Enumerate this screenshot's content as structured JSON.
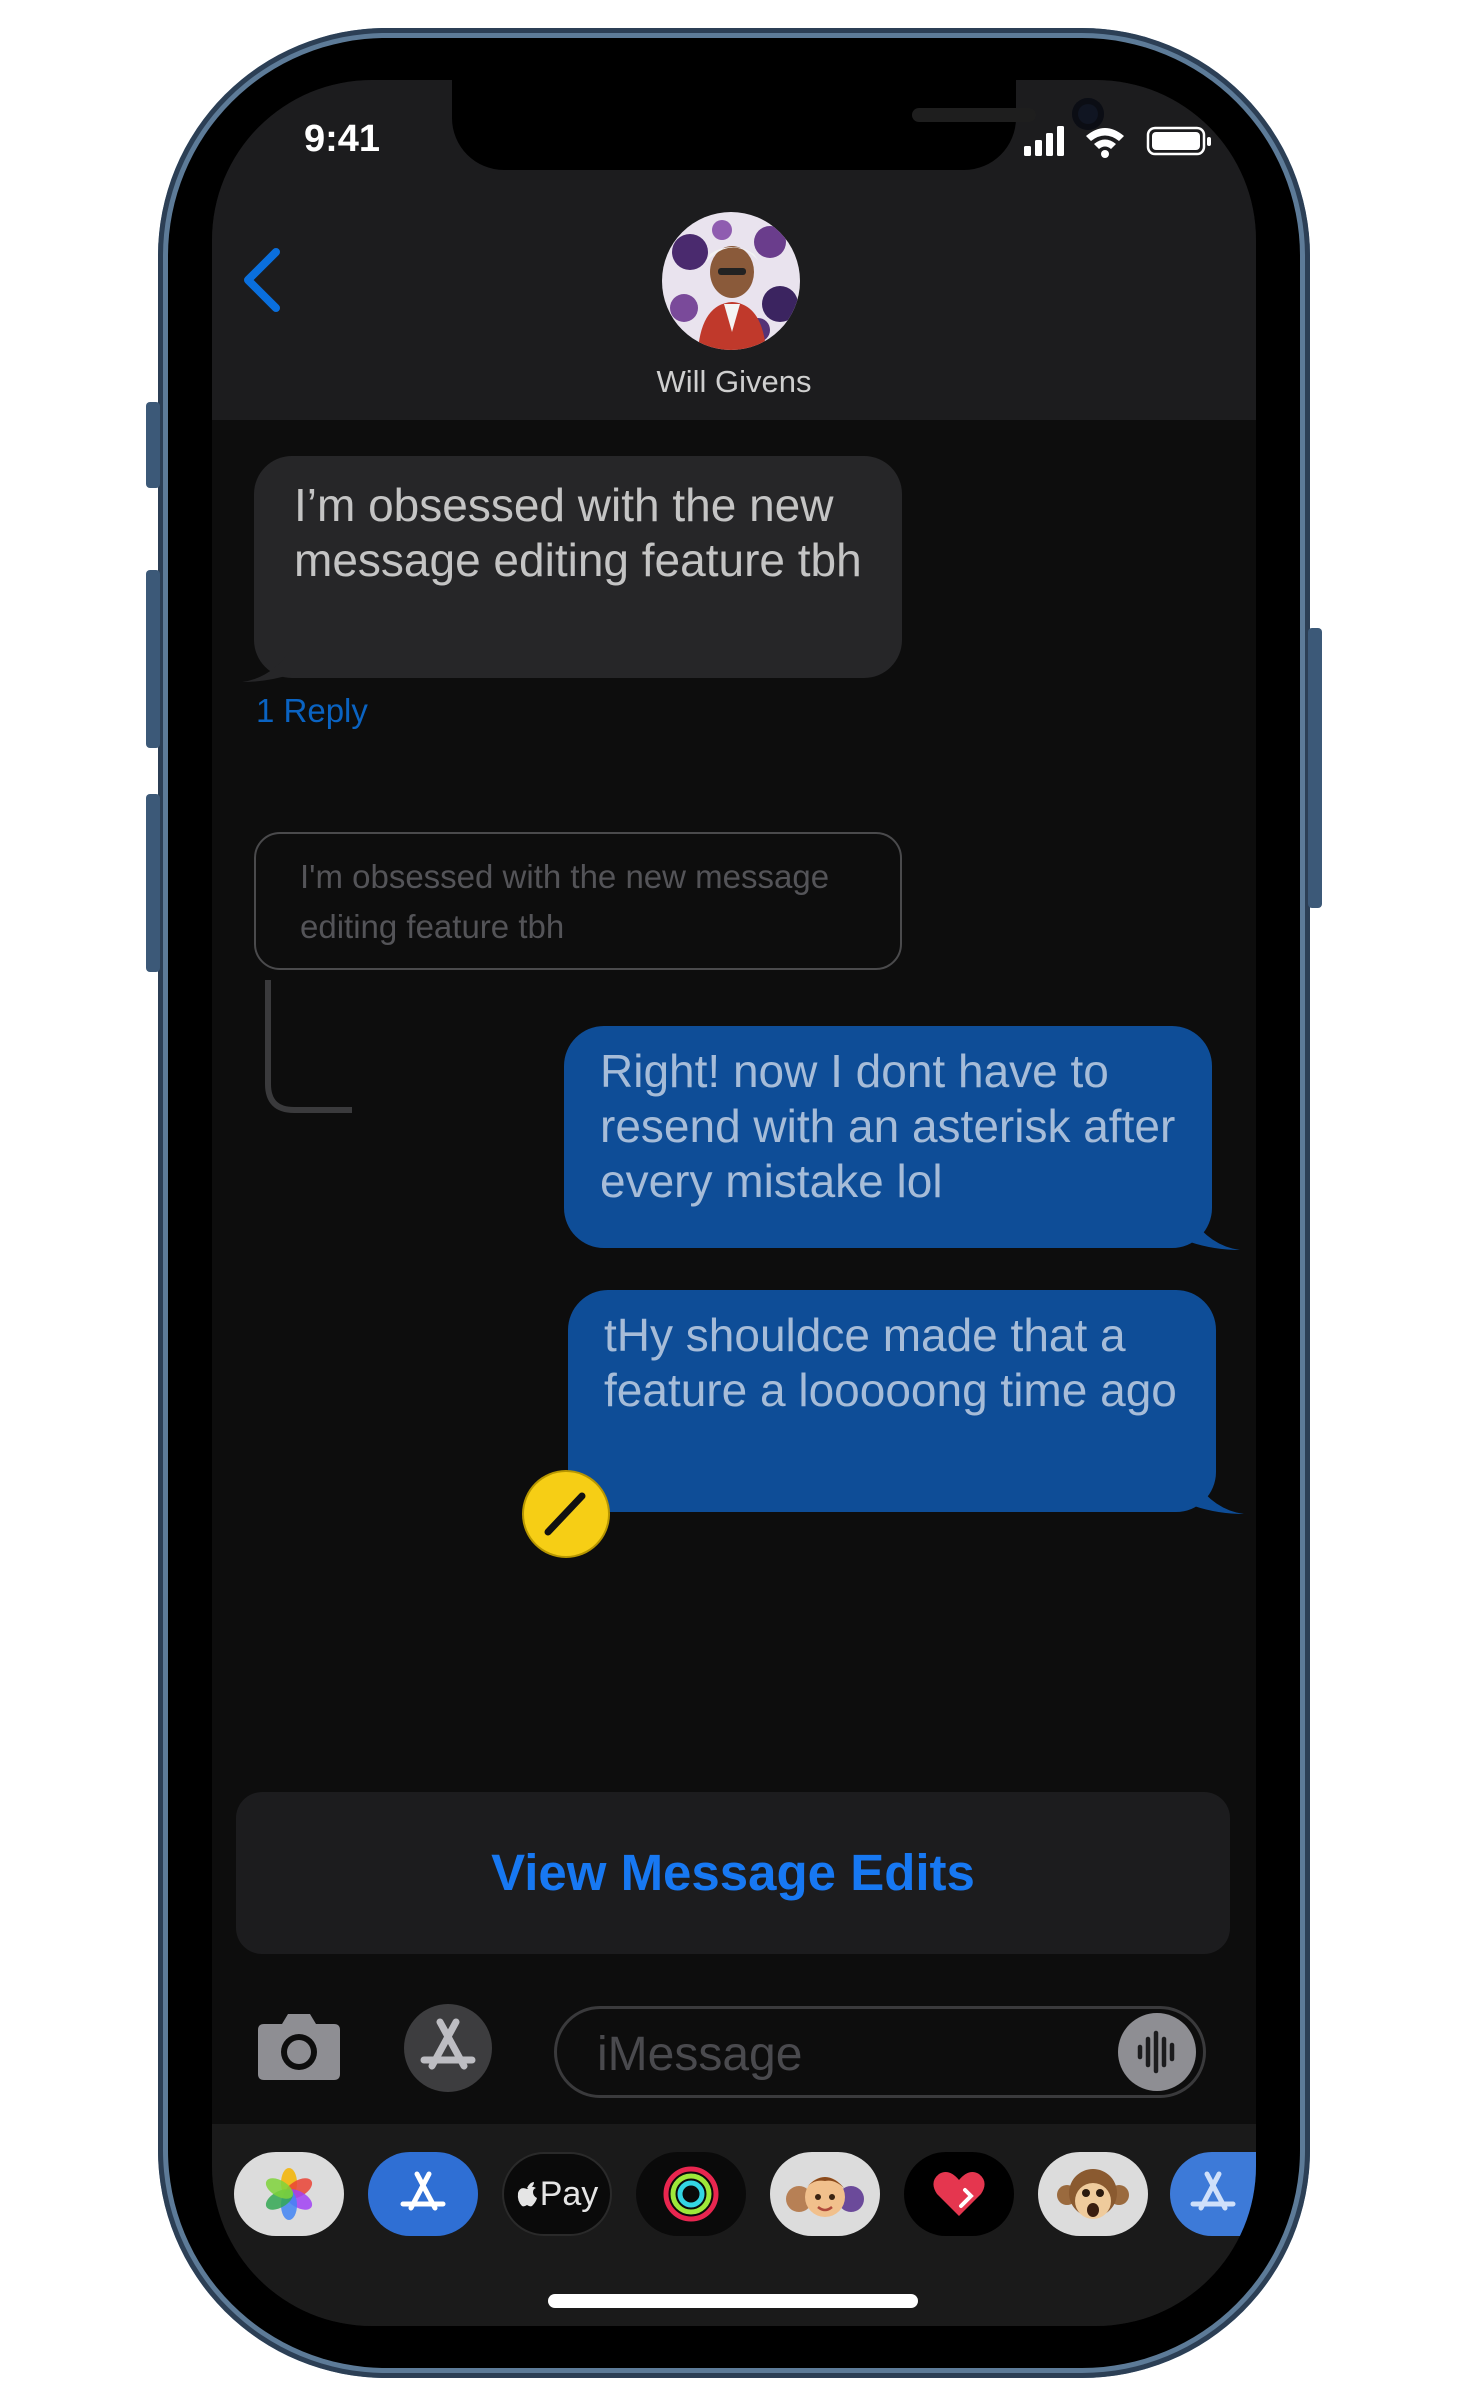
{
  "status_bar": {
    "time": "9:41"
  },
  "header": {
    "contact_name": "Will Givens"
  },
  "messages": [
    {
      "direction": "incoming",
      "text": "I’m obsessed with the new message editing feature tbh",
      "reply_count_label": "1 Reply"
    },
    {
      "direction": "outgoing",
      "quoted_text": "I'm obsessed with the new message editing feature tbh",
      "text": "Right! now I dont have to resend with an asterisk after every mistake lol"
    },
    {
      "direction": "outgoing",
      "text": "tHy shouldce made that a feature a looooong time ago",
      "edited": true
    }
  ],
  "action_sheet": {
    "label": "View Message Edits"
  },
  "composer": {
    "placeholder": "iMessage"
  },
  "app_drawer": {
    "apps": [
      {
        "icon": "photos-icon"
      },
      {
        "icon": "app-store-icon"
      },
      {
        "icon": "apple-pay-icon",
        "label": "Pay"
      },
      {
        "icon": "activity-rings-icon"
      },
      {
        "icon": "memoji-icon"
      },
      {
        "icon": "digital-touch-heart-icon"
      },
      {
        "icon": "monkey-animoji-icon"
      },
      {
        "icon": "app-store-partial-icon"
      }
    ]
  },
  "colors": {
    "bubble_outgoing": "#0e4d97",
    "bubble_incoming": "#262628",
    "accent": "#1778f2",
    "edit_badge": "#f6ce15"
  }
}
